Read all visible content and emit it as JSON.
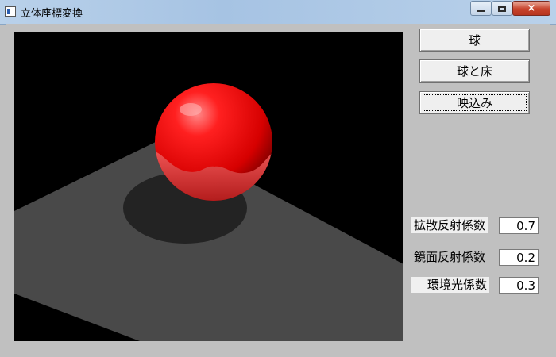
{
  "window": {
    "title": "立体座標変換",
    "icon": "app-window-icon",
    "controls": {
      "minimize": "minimize-icon",
      "maximize": "maximize-icon",
      "close": "×"
    }
  },
  "scene": {
    "background_color": "#000000",
    "floor_color": "#494949",
    "shadow_color": "#232323",
    "sphere_color": "#ff1a1a"
  },
  "buttons": {
    "sphere": "球",
    "sphere_floor": "球と床",
    "reflection": "映込み"
  },
  "params": {
    "diffuse": {
      "label": "拡散反射係数",
      "value": "0.7"
    },
    "specular": {
      "label": "鏡面反射係数",
      "value": "0.2"
    },
    "ambient": {
      "label": "環境光係数",
      "value": "0.3"
    }
  }
}
